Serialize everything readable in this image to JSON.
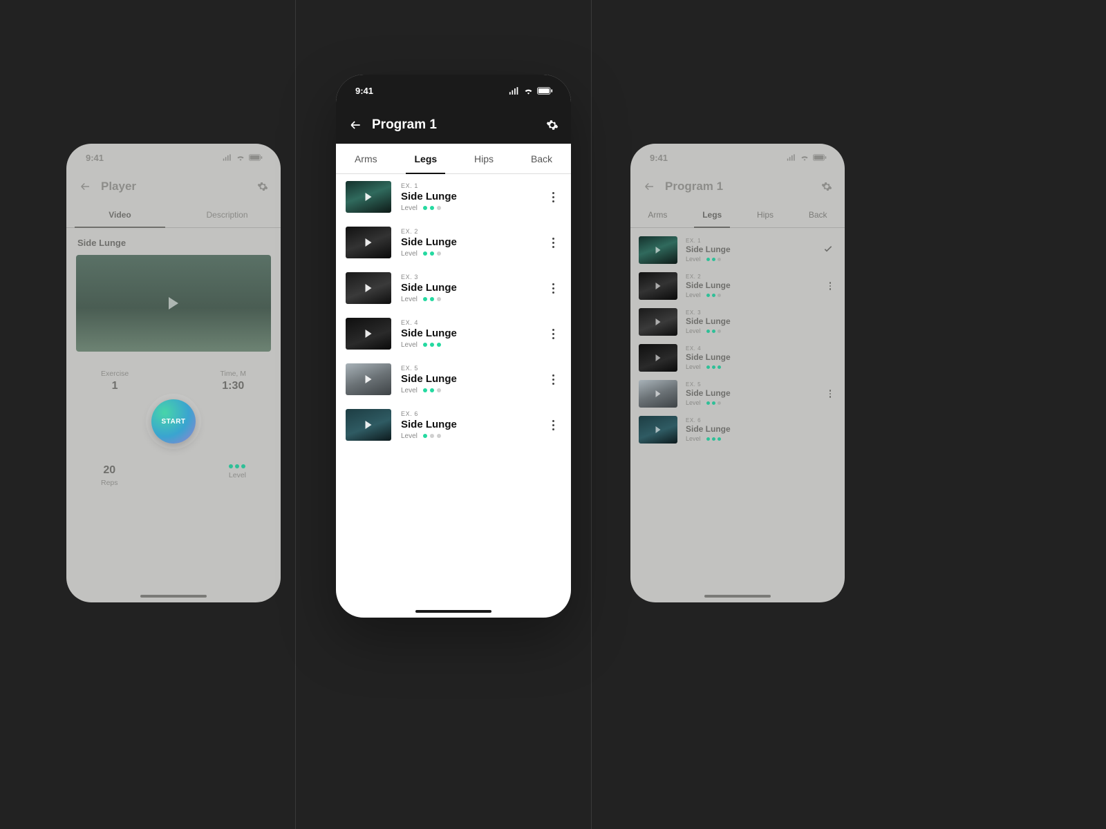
{
  "status_time": "9:41",
  "screenLeft": {
    "title": "Player",
    "tabs": [
      "Video",
      "Description"
    ],
    "activeTab": 0,
    "exercise_name": "Side Lunge",
    "stats": {
      "exercise_label": "Exercise",
      "exercise_value": "1",
      "time_label": "Time, M",
      "time_value": "1:30",
      "reps_value": "20",
      "reps_label": "Reps",
      "level_label": "Level",
      "level": 3
    },
    "start_label": "START"
  },
  "screenCenter": {
    "title": "Program 1",
    "tabs": [
      "Arms",
      "Legs",
      "Hips",
      "Back"
    ],
    "activeTab": 1,
    "level_label": "Level",
    "items": [
      {
        "ex": "EX. 1",
        "name": "Side Lunge",
        "level": 2
      },
      {
        "ex": "EX. 2",
        "name": "Side Lunge",
        "level": 2
      },
      {
        "ex": "EX. 3",
        "name": "Side Lunge",
        "level": 2
      },
      {
        "ex": "EX. 4",
        "name": "Side Lunge",
        "level": 3
      },
      {
        "ex": "EX. 5",
        "name": "Side Lunge",
        "level": 2
      },
      {
        "ex": "EX. 6",
        "name": "Side Lunge",
        "level": 1
      }
    ]
  },
  "screenRight": {
    "title": "Program 1",
    "tabs": [
      "Arms",
      "Legs",
      "Hips",
      "Back"
    ],
    "activeTab": 1,
    "level_label": "Level",
    "items": [
      {
        "ex": "EX. 1",
        "name": "Side Lunge",
        "level": 2,
        "trailing": "check"
      },
      {
        "ex": "EX. 2",
        "name": "Side Lunge",
        "level": 2,
        "trailing": "kebab"
      },
      {
        "ex": "EX. 3",
        "name": "Side Lunge",
        "level": 2,
        "trailing": ""
      },
      {
        "ex": "EX. 4",
        "name": "Side Lunge",
        "level": 3,
        "trailing": ""
      },
      {
        "ex": "EX. 5",
        "name": "Side Lunge",
        "level": 2,
        "trailing": "kebab"
      },
      {
        "ex": "EX. 6",
        "name": "Side Lunge",
        "level": 3,
        "trailing": ""
      }
    ]
  }
}
